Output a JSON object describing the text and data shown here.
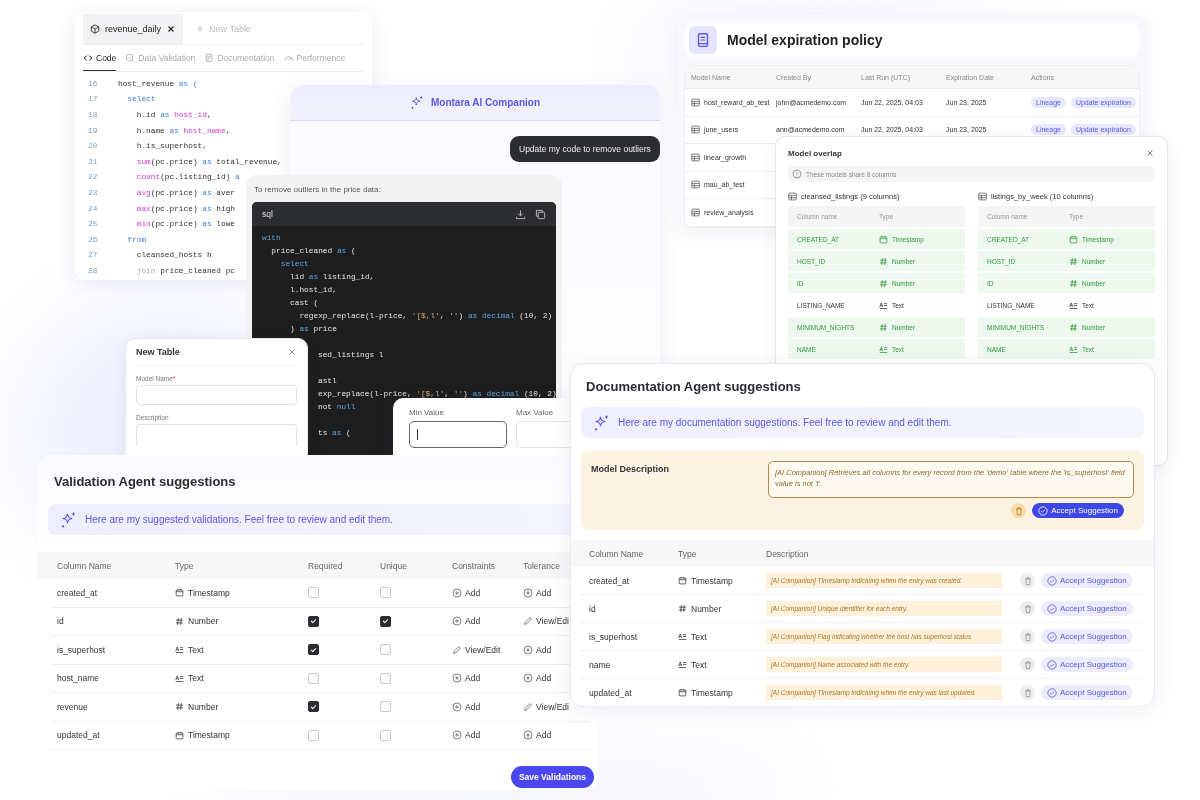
{
  "code_editor": {
    "tabs": [
      {
        "label": "revenue_daily",
        "selected": true
      }
    ],
    "new_tab": "New Table",
    "subtabs": [
      {
        "label": "Code",
        "selected": true
      },
      {
        "label": "Data Validation",
        "selected": false
      },
      {
        "label": "Documentation",
        "selected": false
      },
      {
        "label": "Performence",
        "selected": false
      }
    ],
    "lines": [
      {
        "number": "16",
        "segments": [
          {
            "kind": "plain",
            "text": "host_revenue "
          },
          {
            "kind": "kw",
            "text": "as ("
          }
        ]
      },
      {
        "number": "17",
        "segments": [
          {
            "kind": "kw",
            "text": "  select"
          }
        ]
      },
      {
        "number": "18",
        "segments": [
          {
            "kind": "plain",
            "text": "    h.id "
          },
          {
            "kind": "kw",
            "text": "as "
          },
          {
            "kind": "fn",
            "text": "host_id"
          },
          {
            "kind": "plain",
            "text": ","
          }
        ]
      },
      {
        "number": "19",
        "segments": [
          {
            "kind": "plain",
            "text": "    h.name "
          },
          {
            "kind": "kw",
            "text": "as "
          },
          {
            "kind": "fn",
            "text": "host_name"
          },
          {
            "kind": "plain",
            "text": ","
          }
        ]
      },
      {
        "number": "20",
        "segments": [
          {
            "kind": "plain",
            "text": "    h.is_superhost,"
          }
        ]
      },
      {
        "number": "21",
        "segments": [
          {
            "kind": "fn",
            "text": "    sum"
          },
          {
            "kind": "plain",
            "text": "(pc.price) "
          },
          {
            "kind": "kw",
            "text": "as "
          },
          {
            "kind": "plain",
            "text": "total_revenue,"
          }
        ]
      },
      {
        "number": "22",
        "segments": [
          {
            "kind": "fn",
            "text": "    count"
          },
          {
            "kind": "plain",
            "text": "(pc.listing_id) "
          },
          {
            "kind": "kw",
            "text": "a"
          }
        ]
      },
      {
        "number": "23",
        "segments": [
          {
            "kind": "fn",
            "text": "    avg"
          },
          {
            "kind": "plain",
            "text": "(pc.price) "
          },
          {
            "kind": "kw",
            "text": "as "
          },
          {
            "kind": "plain",
            "text": "aver"
          }
        ]
      },
      {
        "number": "24",
        "segments": [
          {
            "kind": "fn",
            "text": "    max"
          },
          {
            "kind": "plain",
            "text": "(pc.price) "
          },
          {
            "kind": "kw",
            "text": "as "
          },
          {
            "kind": "plain",
            "text": "high"
          }
        ]
      },
      {
        "number": "25",
        "segments": [
          {
            "kind": "fn",
            "text": "    min"
          },
          {
            "kind": "plain",
            "text": "(pc.price) "
          },
          {
            "kind": "kw",
            "text": "as "
          },
          {
            "kind": "plain",
            "text": "lowe"
          }
        ]
      },
      {
        "number": "26",
        "segments": [
          {
            "kind": "kw",
            "text": "  from"
          }
        ]
      },
      {
        "number": "27",
        "segments": [
          {
            "kind": "plain",
            "text": "    cleansed_hosts h"
          }
        ]
      },
      {
        "number": "28",
        "segments": [
          {
            "kind": "dim",
            "text": "    join "
          },
          {
            "kind": "plain",
            "text": "price_cleaned pc"
          }
        ]
      }
    ]
  },
  "model_expiration": {
    "title": "Model expiration policy",
    "columns": [
      "Model Name",
      "Created By",
      "Last Run (UTC)",
      "Expiration Date",
      "Actions"
    ],
    "rows": [
      {
        "name": "host_reward_ab_test",
        "created_by": "john@acmedemo.com",
        "last_run": "Jun 22, 2025, 04:03",
        "expiration": "Jun 23, 2025",
        "actions": [
          "Lineage",
          "Update expiration"
        ]
      },
      {
        "name": "june_users",
        "created_by": "ann@acmedemo.com",
        "last_run": "Jun 22, 2025, 04:03",
        "expiration": "Jun 23, 2025",
        "actions": [
          "Lineage",
          "Update expiration"
        ]
      },
      {
        "name": "linear_growth"
      },
      {
        "name": "mau_ab_test"
      },
      {
        "name": "review_analysis"
      }
    ]
  },
  "ai_companion": {
    "title": "Montara AI Companion",
    "user_message": "Update my code to remove outliers",
    "reply": "To remove outliers in the price data:",
    "code_language": "sql",
    "code": [
      {
        "segments": [
          {
            "kind": "kw",
            "text": "with"
          }
        ]
      },
      {
        "segments": [
          {
            "kind": "plain",
            "text": "  price_cleaned "
          },
          {
            "kind": "kw",
            "text": "as"
          },
          {
            "kind": "plain",
            "text": " ("
          }
        ]
      },
      {
        "segments": [
          {
            "kind": "kw",
            "text": "    select"
          }
        ]
      },
      {
        "segments": [
          {
            "kind": "plain",
            "text": "      lid "
          },
          {
            "kind": "kw",
            "text": "as"
          },
          {
            "kind": "plain",
            "text": " listing_id,"
          }
        ]
      },
      {
        "segments": [
          {
            "kind": "plain",
            "text": "      l.host_id,"
          }
        ]
      },
      {
        "segments": [
          {
            "kind": "plain",
            "text": "      cast ("
          }
        ]
      },
      {
        "segments": [
          {
            "kind": "plain",
            "text": "        regexp_replace(l-price, "
          },
          {
            "kind": "str",
            "text": "'[$,l'"
          },
          {
            "kind": "plain",
            "text": ", "
          },
          {
            "kind": "str",
            "text": "''"
          },
          {
            "kind": "plain",
            "text": ") "
          },
          {
            "kind": "kw",
            "text": "as decimal"
          },
          {
            "kind": "plain",
            "text": " (10, 2)"
          }
        ]
      },
      {
        "segments": [
          {
            "kind": "plain",
            "text": "      ) "
          },
          {
            "kind": "kw",
            "text": "as"
          },
          {
            "kind": "plain",
            "text": " price"
          }
        ]
      },
      {
        "segments": [
          {
            "kind": "plain",
            "text": "sed_listings l"
          }
        ]
      },
      {
        "segments": [
          {
            "kind": "plain",
            "text": "astl"
          }
        ]
      },
      {
        "segments": [
          {
            "kind": "plain",
            "text": "exp_replace(l-price, "
          },
          {
            "kind": "str",
            "text": "'[$,l'"
          },
          {
            "kind": "plain",
            "text": ", "
          },
          {
            "kind": "str",
            "text": "''"
          },
          {
            "kind": "plain",
            "text": ") "
          },
          {
            "kind": "kw",
            "text": "as decimal"
          },
          {
            "kind": "plain",
            "text": " (10, 2)"
          }
        ]
      },
      {
        "segments": [
          {
            "kind": "plain",
            "text": "not "
          },
          {
            "kind": "kw",
            "text": "null"
          }
        ]
      },
      {
        "segments": [
          {
            "kind": "plain",
            "text": "ts "
          },
          {
            "kind": "kw",
            "text": "as"
          },
          {
            "kind": "plain",
            "text": " ("
          }
        ]
      }
    ]
  },
  "model_overlap": {
    "title": "Model overlap",
    "info": "These models share 8 columns",
    "tables": [
      {
        "title": "cleansed_listings (9 columns)",
        "columns": [
          "Column name",
          "Type"
        ],
        "rows": [
          {
            "name": "CREATED_AT",
            "kind": "timestamp",
            "type_label": "Timestamp",
            "matched": true
          },
          {
            "name": "HOST_ID",
            "kind": "number",
            "type_label": "Number",
            "matched": true
          },
          {
            "name": "ID",
            "kind": "number",
            "type_label": "Number",
            "matched": true
          },
          {
            "name": "LISTING_NAME",
            "kind": "text",
            "type_label": "Text",
            "matched": false
          },
          {
            "name": "MINIMUM_NIGHTS",
            "kind": "number",
            "type_label": "Number",
            "matched": true
          },
          {
            "name": "NAME",
            "kind": "text",
            "type_label": "Text",
            "matched": true
          }
        ]
      },
      {
        "title": "listings_by_week (10 columns)",
        "columns": [
          "Column name",
          "Type"
        ],
        "rows": [
          {
            "name": "CREATED_AT",
            "kind": "timestamp",
            "type_label": "Timestamp",
            "matched": true
          },
          {
            "name": "HOST_ID",
            "kind": "number",
            "type_label": "Number",
            "matched": true
          },
          {
            "name": "ID",
            "kind": "number",
            "type_label": "Number",
            "matched": true
          },
          {
            "name": "LISTING_NAME",
            "kind": "text",
            "type_label": "Text",
            "matched": false
          },
          {
            "name": "MINIMUM_NIGHTS",
            "kind": "number",
            "type_label": "Number",
            "matched": true
          },
          {
            "name": "NAME",
            "kind": "text",
            "type_label": "Text",
            "matched": true
          }
        ]
      }
    ]
  },
  "new_table": {
    "title": "New Table",
    "fields": [
      {
        "label": "Model Name",
        "required_mark": "*"
      },
      {
        "label": "Description"
      }
    ]
  },
  "range": {
    "fields": [
      {
        "label": "Min Value",
        "focused": true
      },
      {
        "label": "Max Value",
        "focused": false
      }
    ]
  },
  "validation": {
    "title": "Validation Agent suggestions",
    "banner": "Here are my suggested validations. Feel free to review and edit them.",
    "columns": [
      "Column Name",
      "Type",
      "Required",
      "Unique",
      "Constraints",
      "Tolerance"
    ],
    "rows": [
      {
        "name": "created_at",
        "kind": "timestamp",
        "type_label": "Timestamp",
        "required": false,
        "unique": false,
        "constraints": {
          "kind": "add",
          "label": "Add"
        },
        "tolerance": {
          "kind": "add",
          "label": "Add"
        }
      },
      {
        "name": "id",
        "kind": "number",
        "type_label": "Number",
        "required": true,
        "unique": true,
        "constraints": {
          "kind": "add",
          "label": "Add"
        },
        "tolerance": {
          "kind": "edit",
          "label": "View/Edi"
        }
      },
      {
        "name": "is_superhost",
        "kind": "text",
        "type_label": "Text",
        "required": true,
        "unique": false,
        "constraints": {
          "kind": "edit",
          "label": "View/Edit"
        },
        "tolerance": {
          "kind": "add",
          "label": "Add"
        }
      },
      {
        "name": "host_name",
        "kind": "text",
        "type_label": "Text",
        "required": false,
        "unique": false,
        "constraints": {
          "kind": "add",
          "label": "Add"
        },
        "tolerance": {
          "kind": "add",
          "label": "Add"
        }
      },
      {
        "name": "revenue",
        "kind": "number",
        "type_label": "Number",
        "required": true,
        "unique": false,
        "constraints": {
          "kind": "add",
          "label": "Add"
        },
        "tolerance": {
          "kind": "edit",
          "label": "View/Edi"
        }
      },
      {
        "name": "updated_at",
        "kind": "timestamp",
        "type_label": "Timestamp",
        "required": false,
        "unique": false,
        "constraints": {
          "kind": "add",
          "label": "Add"
        },
        "tolerance": {
          "kind": "add",
          "label": "Add"
        }
      }
    ],
    "save_button": "Save Validations"
  },
  "documentation": {
    "title": "Documentation Agent suggestions",
    "banner": "Here are my documentation suggestions. Feel free to review and edit them.",
    "model_description": {
      "label": "Model Description",
      "text": "[AI Companion] Retrieves all columns for every record from the 'demo' table where the 'is_superhost' field value is not 't'.",
      "accept": "Accept Suggestion"
    },
    "columns": [
      "Column Name",
      "Type",
      "Description"
    ],
    "rows": [
      {
        "name": "created_at",
        "kind": "timestamp",
        "type_label": "Timestamp",
        "description": "[AI Companion] Timestamp indicating when the entry was created.",
        "accept": "Accept Suggestion"
      },
      {
        "name": "id",
        "kind": "number",
        "type_label": "Number",
        "description": "[AI Companion] Unique identifier for each entry.",
        "accept": "Accept Suggestion"
      },
      {
        "name": "is_superhost",
        "kind": "text",
        "type_label": "Text",
        "description": "[AI Companion] Flag indicating whether the host has superhost status",
        "accept": "Accept Suggestion"
      },
      {
        "name": "name",
        "kind": "text",
        "type_label": "Text",
        "description": "[AI Companion] Name associated with the entry.",
        "accept": "Accept Suggestion"
      },
      {
        "name": "updated_at",
        "kind": "timestamp",
        "type_label": "Timestamp",
        "description": "[AI Companion] Timestamp indicating when the entry was last updated.",
        "accept": "Accept Suggestion"
      }
    ]
  }
}
